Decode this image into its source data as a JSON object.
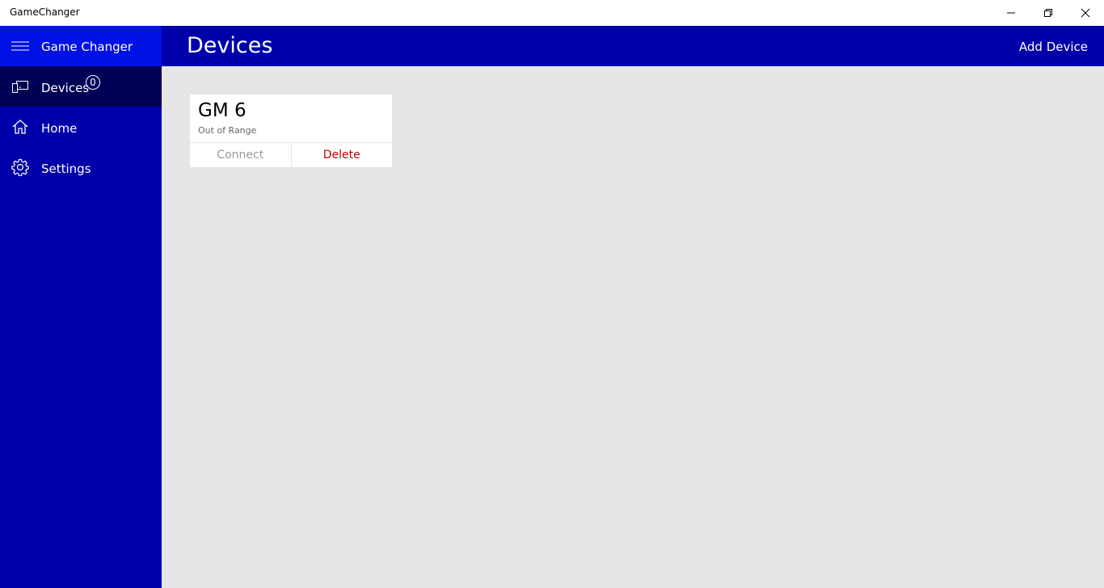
{
  "window": {
    "title": "GameChanger",
    "controls": {
      "minimize_icon": "minimize-icon",
      "restore_icon": "restore-icon",
      "close_icon": "close-icon"
    }
  },
  "nav": {
    "app_name": "Game Changer",
    "menu_icon": "hamburger-icon",
    "items": [
      {
        "label": "Devices",
        "icon": "devices-icon",
        "badge": "0",
        "selected": true
      },
      {
        "label": "Home",
        "icon": "home-icon",
        "selected": false
      },
      {
        "label": "Settings",
        "icon": "gear-icon",
        "selected": false
      }
    ]
  },
  "header": {
    "title": "Devices",
    "add_device_label": "Add Device"
  },
  "devices": [
    {
      "name": "GM 6",
      "status": "Out of Range",
      "connect_label": "Connect",
      "delete_label": "Delete"
    }
  ],
  "colors": {
    "nav_background": "#0000aa",
    "nav_header": "#0011e6",
    "nav_selected": "#000055",
    "content_background": "#e6e6e6",
    "delete": "#c00000",
    "connect_disabled": "#999999"
  }
}
